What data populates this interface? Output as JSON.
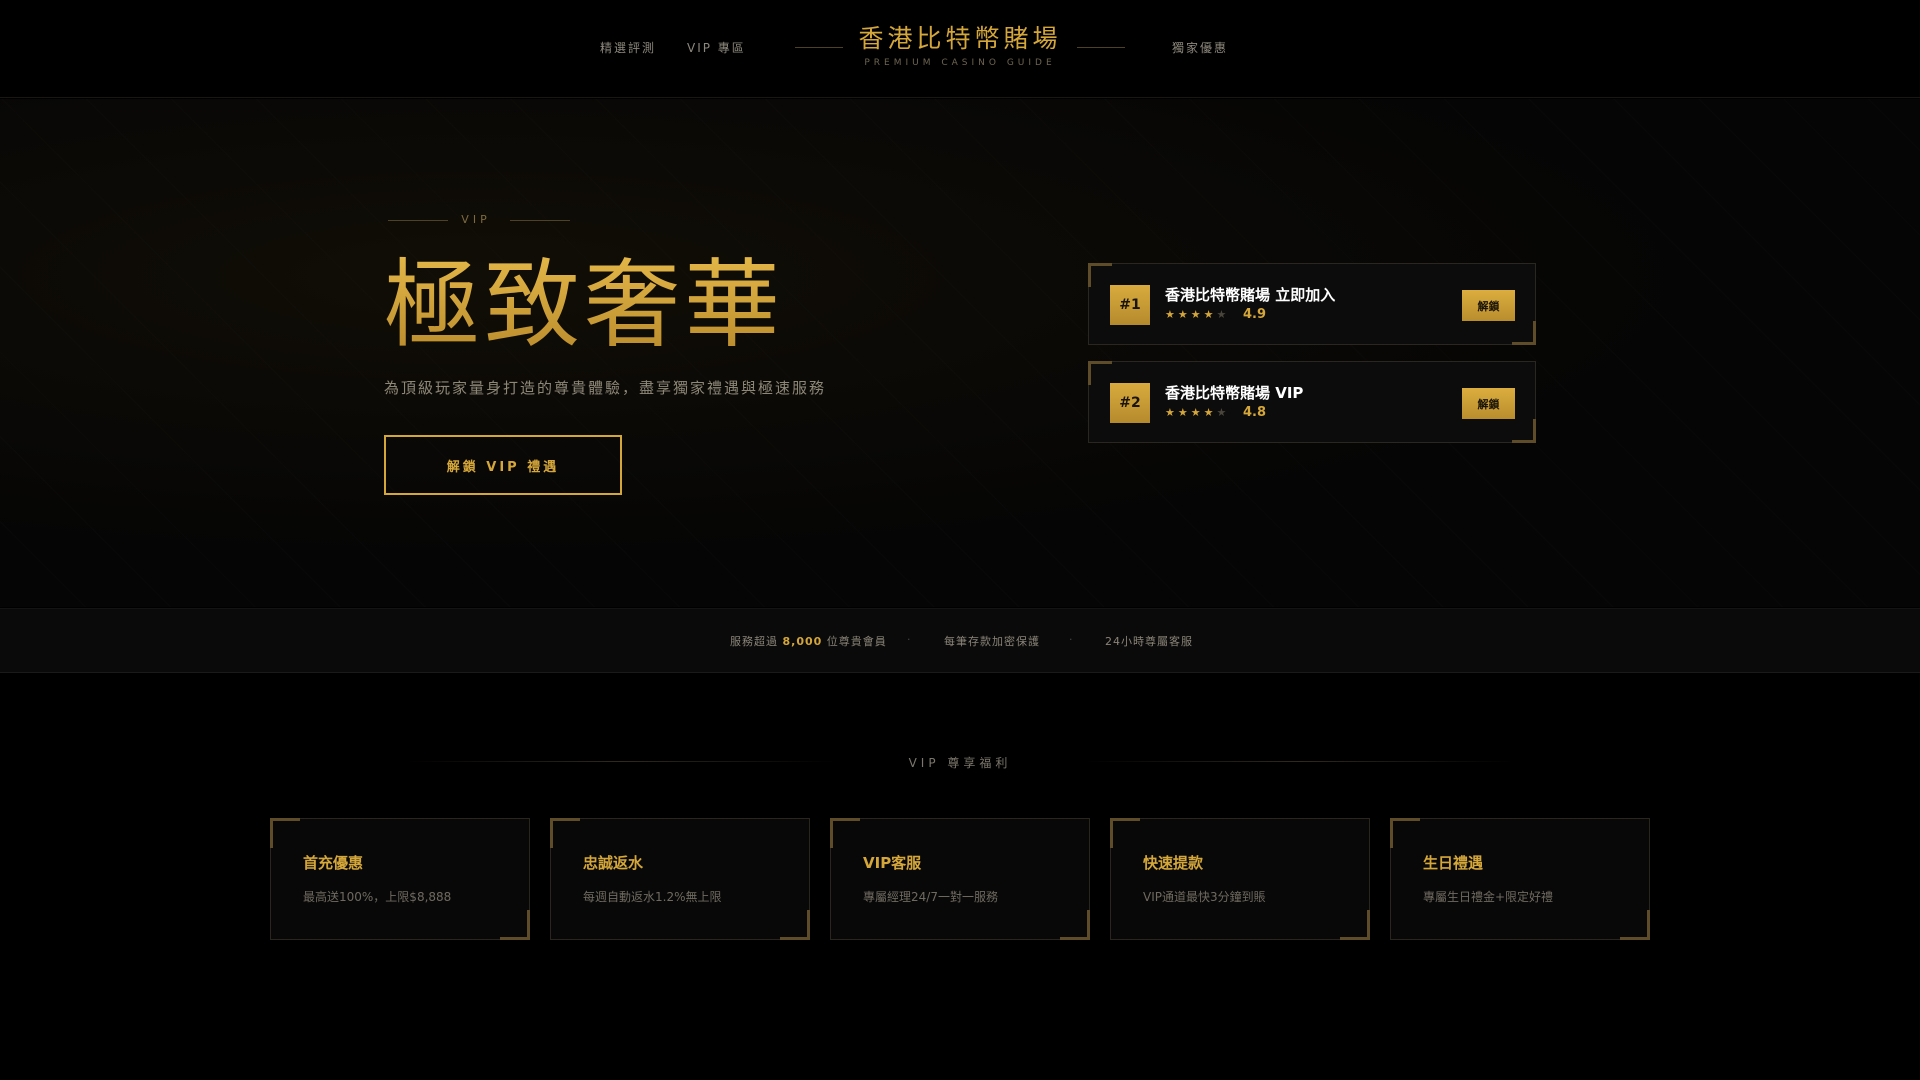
{
  "header": {
    "nav_left": [
      "精選評測",
      "VIP 專區"
    ],
    "nav_right": [
      "獨家優惠"
    ],
    "brand_title": "香港比特幣賭場",
    "brand_subtitle": "PREMIUM CASINO GUIDE"
  },
  "hero": {
    "eyebrow": "VIP",
    "title": "極致奢華",
    "subtitle": "為頂級玩家量身打造的尊貴體驗，盡享獨家禮遇與極速服務",
    "cta_label": "解鎖 VIP 禮遇"
  },
  "rankings": [
    {
      "rank": "#1",
      "name": "香港比特幣賭場 立即加入",
      "stars_filled": 4,
      "stars_total": 5,
      "score": "4.9",
      "button": "解鎖"
    },
    {
      "rank": "#2",
      "name": "香港比特幣賭場 VIP",
      "stars_filled": 4,
      "stars_total": 5,
      "score": "4.8",
      "button": "解鎖"
    }
  ],
  "stats": {
    "members_prefix": "服務超過",
    "members_count": "8,000",
    "members_suffix": "位尊貴會員",
    "separator": "·",
    "encryption": "每筆存款加密保護",
    "support": "24小時尊屬客服"
  },
  "benefits_section": {
    "title": "VIP 尊享福利",
    "items": [
      {
        "title": "首充優惠",
        "desc": "最高送100%，上限$8,888"
      },
      {
        "title": "忠誠返水",
        "desc": "每週自動返水1.2%無上限"
      },
      {
        "title": "VIP客服",
        "desc": "專屬經理24/7一對一服務"
      },
      {
        "title": "快速提款",
        "desc": "VIP通道最快3分鐘到賬"
      },
      {
        "title": "生日禮遇",
        "desc": "專屬生日禮金+限定好禮"
      }
    ]
  },
  "colors": {
    "accent_gold": "#d5a73a",
    "background": "#000000",
    "card_border": "#2a2720"
  }
}
